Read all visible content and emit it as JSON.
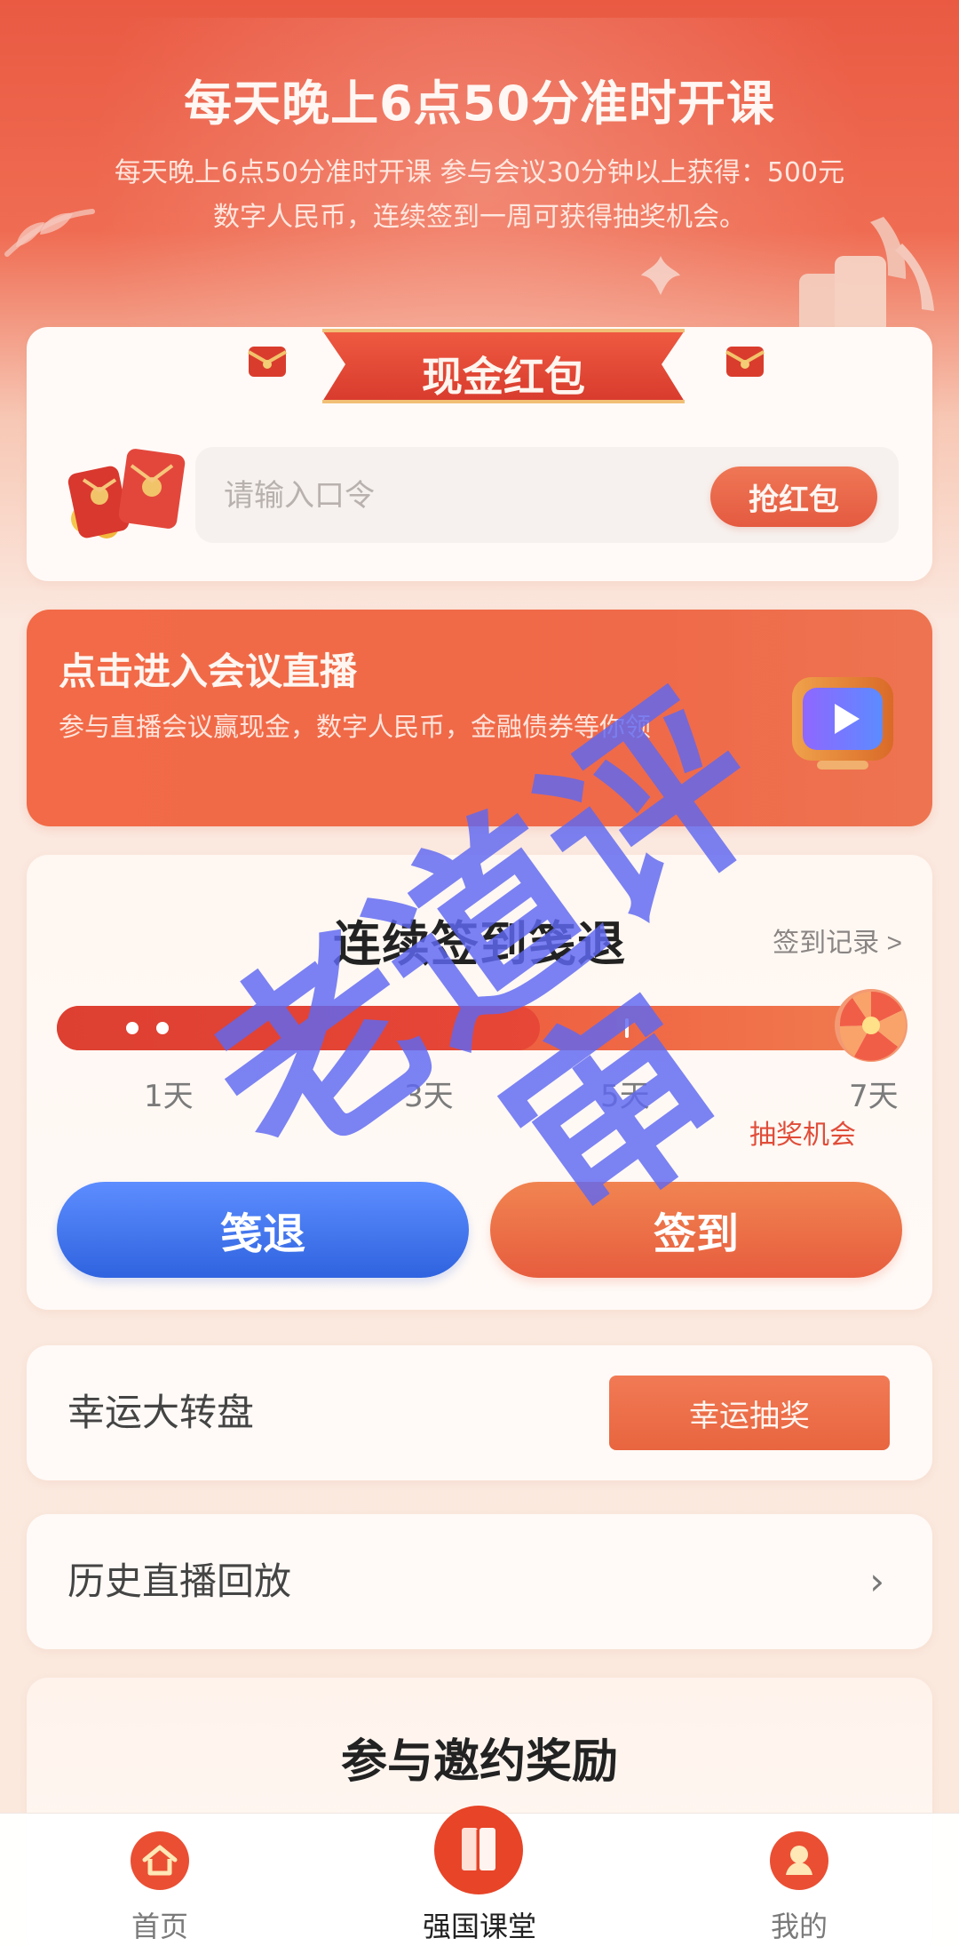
{
  "hero": {
    "title": "每天晚上6点50分准时开课",
    "subtitle_line_1": "每天晚上6点50分准时开课 参与会议30分钟以上获得：500元",
    "subtitle_line_2": "数字人民币，连续签到一周可获得抽奖机会。"
  },
  "red_packet": {
    "title": "现金红包",
    "placeholder": "请输入口令",
    "button": "抢红包"
  },
  "live": {
    "title": "点击进入会议直播",
    "description": "参与直播会议赢现金，数字人民币，金融债券等你领"
  },
  "checkin": {
    "title": "连续签到笺退",
    "records_link": "签到记录 >",
    "progress": 0.58,
    "days": {
      "day1": "1天",
      "day3": "3天",
      "day5": "5天",
      "day7": "7天"
    },
    "lottery_chance": "抽奖机会",
    "left_button": "笺退",
    "right_button": "签到"
  },
  "wheel": {
    "label": "幸运大转盘",
    "button": "幸运抽奖"
  },
  "history": {
    "label": "历史直播回放",
    "chevron": "›"
  },
  "invite": {
    "title": "参与邀约奖励"
  },
  "watermark": {
    "text": "老道评审"
  },
  "bottom_nav": {
    "home": "首页",
    "classroom": "强国课堂",
    "mine": "我的"
  },
  "colors": {
    "accent_red": "#e85a40",
    "accent_blue": "#3f73ea",
    "watermark_blue": "#5f68f2"
  },
  "icons": {
    "leaf": "leaf-icon",
    "red_packet": "red-packet-icon",
    "video_play": "video-play-icon",
    "wheel": "prize-wheel-icon",
    "home": "home-icon",
    "classroom": "book-icon",
    "mine": "user-icon"
  }
}
